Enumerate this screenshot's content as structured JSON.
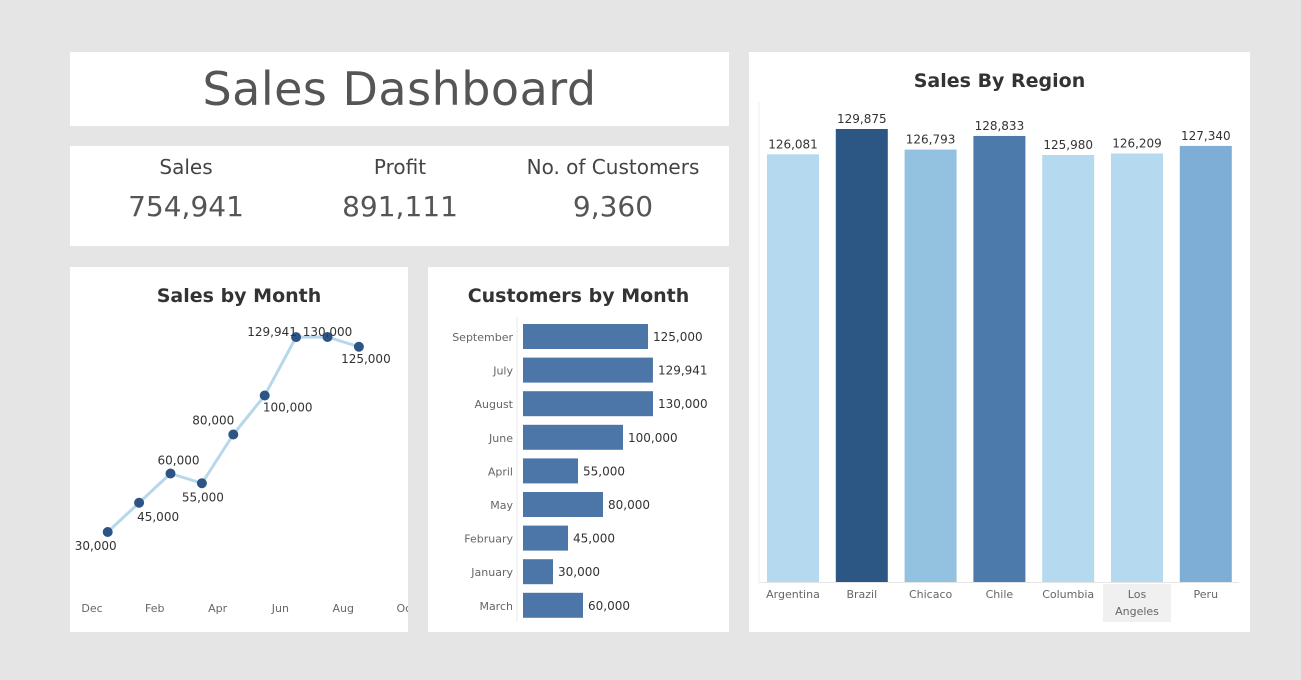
{
  "header": {
    "title": "Sales Dashboard"
  },
  "kpis": [
    {
      "label": "Sales",
      "value": "754,941"
    },
    {
      "label": "Profit",
      "value": "891,111"
    },
    {
      "label": "No. of Customers",
      "value": "9,360"
    }
  ],
  "colors": {
    "background": "#e5e5e5",
    "panel": "#ffffff",
    "line": "#b7d7ea",
    "point": "#2c5585",
    "bar_medium": "#4c76a8",
    "light_blue": "#b5d9ee",
    "mid_light_blue": "#93c2e1",
    "sky_blue": "#7eaed5",
    "steel_blue": "#4b7aab",
    "dark_blue": "#2c5684"
  },
  "chart_data": [
    {
      "type": "line",
      "title": "Sales by Month",
      "points": [
        {
          "x": 0,
          "y": 30000,
          "label": "30,000"
        },
        {
          "x": 1,
          "y": 45000,
          "label": "45,000"
        },
        {
          "x": 2,
          "y": 60000,
          "label": "60,000"
        },
        {
          "x": 3,
          "y": 55000,
          "label": "55,000"
        },
        {
          "x": 4,
          "y": 80000,
          "label": "80,000"
        },
        {
          "x": 5,
          "y": 100000,
          "label": "100,000"
        },
        {
          "x": 6,
          "y": 129941,
          "label": "129,941"
        },
        {
          "x": 7,
          "y": 130000,
          "label": "130,000"
        },
        {
          "x": 8,
          "y": 125000,
          "label": "125,000"
        }
      ],
      "xticks": [
        {
          "x": -0.5,
          "label": "Dec"
        },
        {
          "x": 1.5,
          "label": "Feb"
        },
        {
          "x": 3.5,
          "label": "Apr"
        },
        {
          "x": 5.5,
          "label": "Jun"
        },
        {
          "x": 7.5,
          "label": "Aug"
        },
        {
          "x": 9.5,
          "label": "Oct"
        }
      ],
      "xlim": [
        -0.5,
        9.5
      ],
      "ylim": [
        30000,
        130000
      ],
      "grid": false
    },
    {
      "type": "bar",
      "orientation": "horizontal",
      "title": "Customers by Month",
      "categories": [
        "September",
        "July",
        "August",
        "June",
        "April",
        "May",
        "February",
        "January",
        "March"
      ],
      "values": [
        125000,
        129941,
        130000,
        100000,
        55000,
        80000,
        45000,
        30000,
        60000
      ],
      "labels": [
        "125,000",
        "129,941",
        "130,000",
        "100,000",
        "55,000",
        "80,000",
        "45,000",
        "30,000",
        "60,000"
      ],
      "xlim": [
        0,
        130000
      ],
      "grid": false
    },
    {
      "type": "bar",
      "title": "Sales By Region",
      "categories": [
        "Argentina",
        "Brazil",
        "Chicaco",
        "Chile",
        "Columbia",
        "Los Angeles",
        "Peru"
      ],
      "values": [
        126081,
        129875,
        126793,
        128833,
        125980,
        126209,
        127340
      ],
      "labels": [
        "126,081",
        "129,875",
        "126,793",
        "128,833",
        "125,980",
        "126,209",
        "127,340"
      ],
      "colors": [
        "#b5d9ee",
        "#2c5684",
        "#93c2e1",
        "#4b7aab",
        "#b5d9ee",
        "#b5d9ee",
        "#7eaed5"
      ],
      "grid": false
    }
  ]
}
